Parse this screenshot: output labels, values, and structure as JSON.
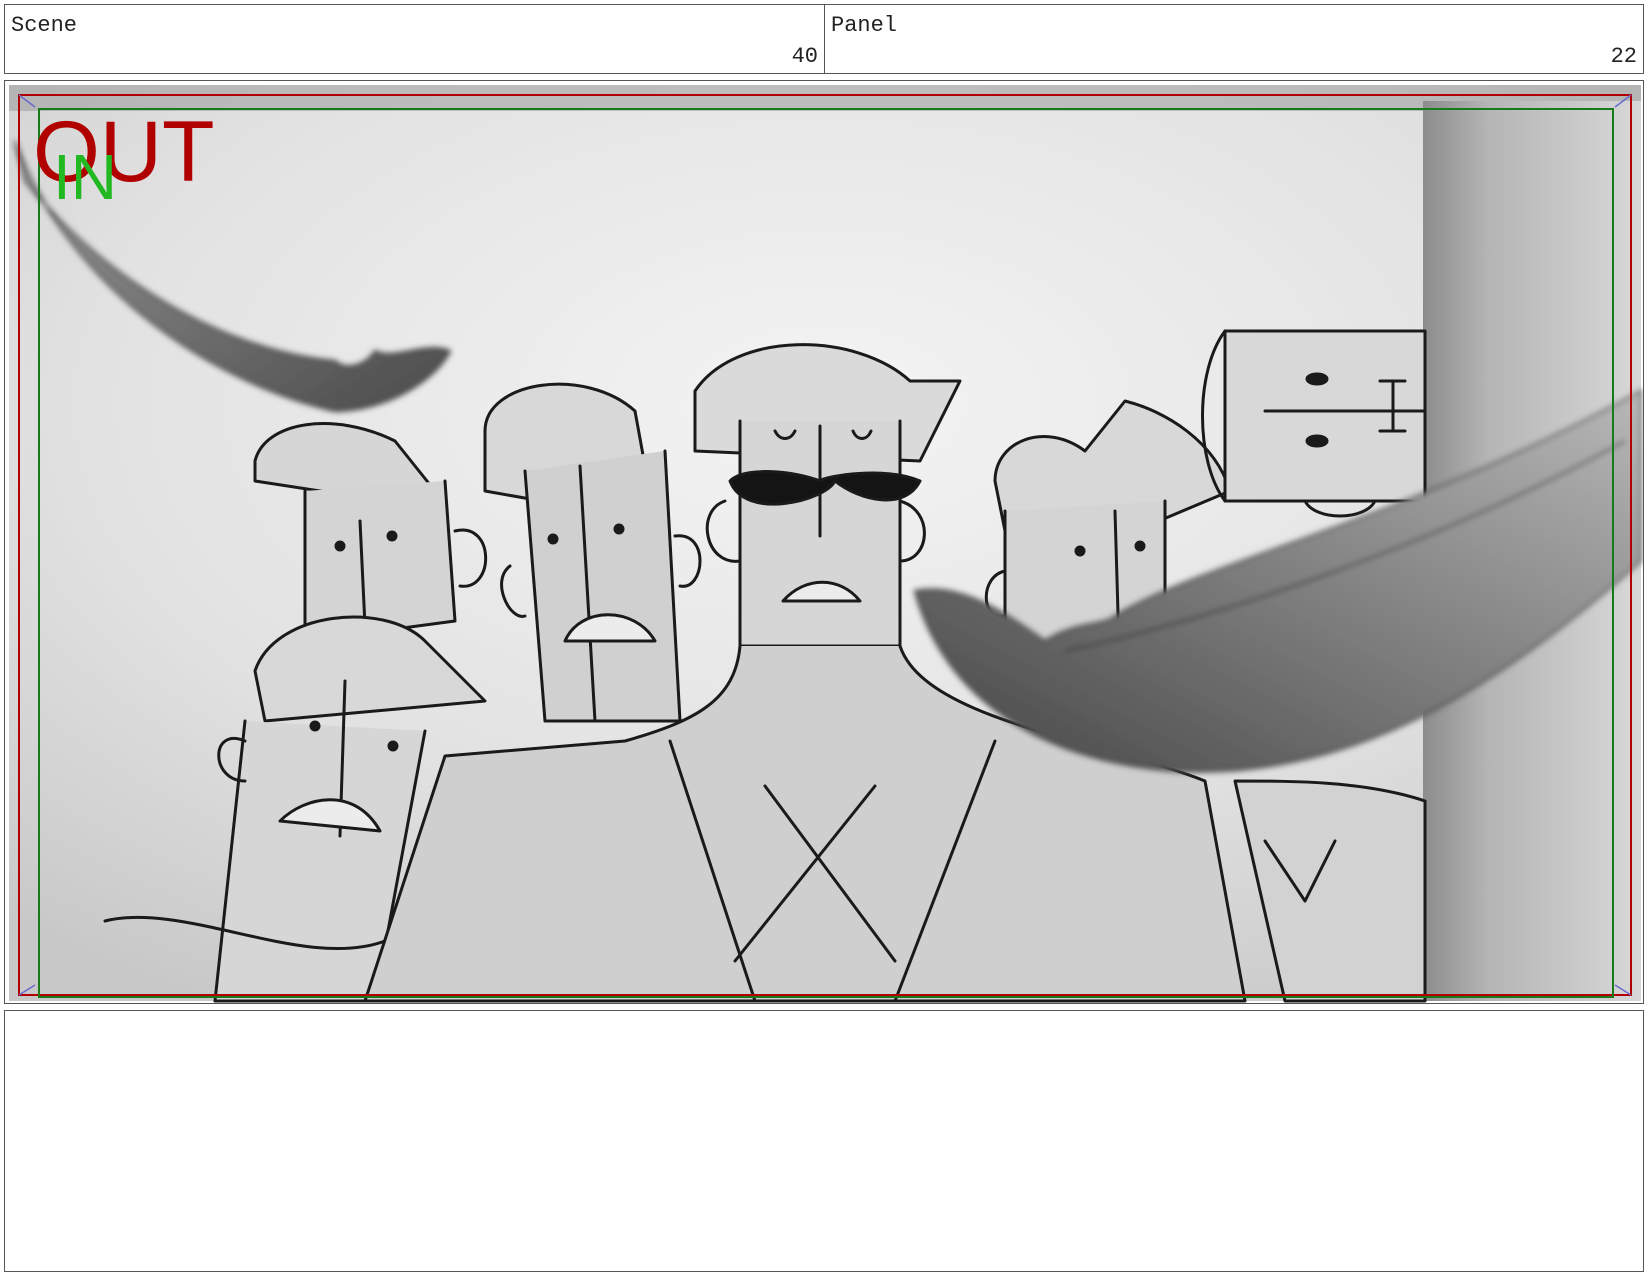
{
  "header": {
    "scene_label": "Scene",
    "scene_number": "40",
    "panel_label": "Panel",
    "panel_number": "22"
  },
  "frame": {
    "out_label": "OUT",
    "in_label": "IN",
    "colors": {
      "out_frame": "#b00000",
      "in_frame": "#1a7a1a",
      "in_text": "#22b822",
      "line_art": "#1a1a1a"
    }
  },
  "notes": {
    "text": ""
  }
}
